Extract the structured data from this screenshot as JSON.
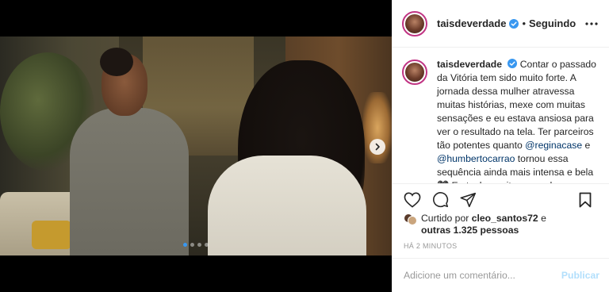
{
  "post": {
    "username": "taisdeverdade",
    "following_label": "Seguindo",
    "separator": "•",
    "caption_text": "Contar o passado da Vitória tem sido muito forte. A jornada dessa mulher atravessa muitas histórias, mexe com muitas sensações e eu estava ansiosa para ver o resultado na tela. Ter parceiros tão potentes quanto",
    "mention_1": "@reginacase",
    "caption_join": "e",
    "mention_2": "@humbertocarrao",
    "caption_text_2": "tornou essa sequência ainda mais intensa e bela 🖤 Eu tenho muito a agradecer a",
    "liked_by_prefix": "Curtido por",
    "liked_by_user": "cleo_santos72",
    "liked_by_suffix": "e",
    "others_count": "outras 1.325 pessoas",
    "timestamp": "HÁ 2 MINUTOS",
    "carousel": {
      "total": 4,
      "active_index": 0
    }
  },
  "comment": {
    "placeholder": "Adicione um comentário...",
    "publish_label": "Publicar"
  },
  "icons": {
    "verified": "verified-badge-icon",
    "more": "more-options-icon",
    "like": "heart-icon",
    "comment": "comment-icon",
    "share": "share-icon",
    "save": "bookmark-icon",
    "next": "chevron-right-icon"
  },
  "colors": {
    "verified_blue": "#3897f0",
    "mention": "#003569",
    "publish_disabled": "#b2dffc",
    "muted": "#999999"
  }
}
